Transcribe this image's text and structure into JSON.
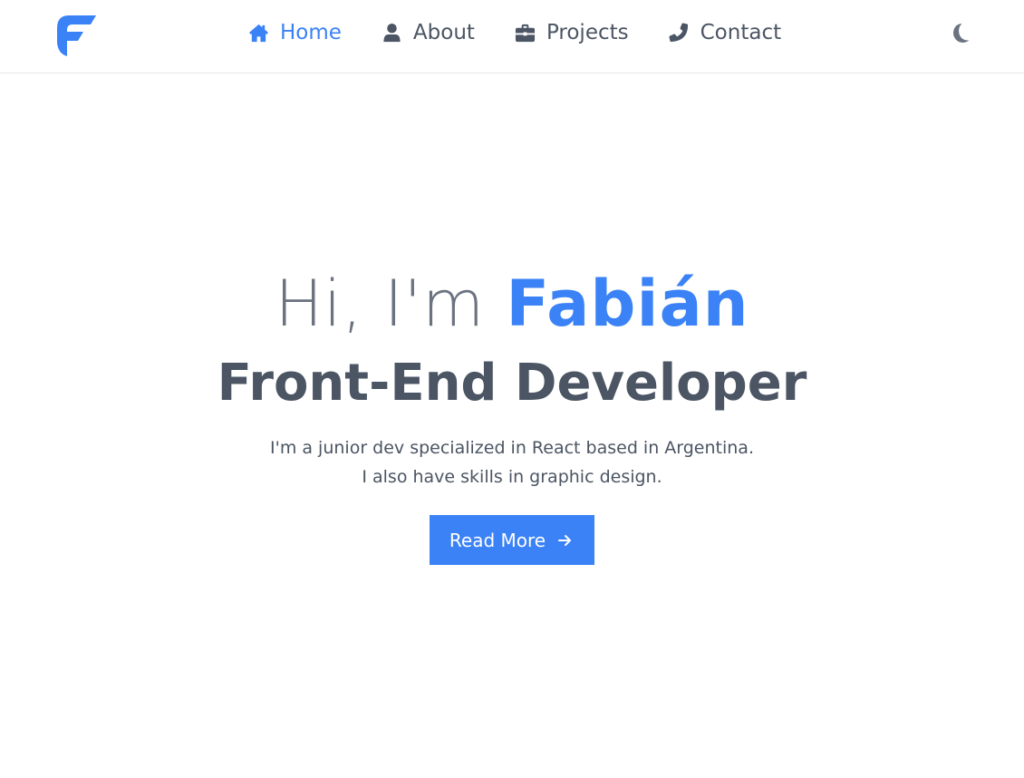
{
  "navbar": {
    "logo_icon": "f-logo-icon",
    "items": [
      {
        "label": "Home",
        "icon": "home-icon",
        "active": true
      },
      {
        "label": "About",
        "icon": "user-icon",
        "active": false
      },
      {
        "label": "Projects",
        "icon": "briefcase-icon",
        "active": false
      },
      {
        "label": "Contact",
        "icon": "phone-icon",
        "active": false
      }
    ],
    "theme_toggle_icon": "moon-icon"
  },
  "hero": {
    "greeting_prefix": "Hi, I'm",
    "greeting_name": "Fabián",
    "role": "Front-End Developer",
    "description_lines": [
      "I'm a junior dev specialized in React based in Argentina.",
      "I also have skills in graphic design."
    ],
    "cta_label": "Read More",
    "cta_icon": "arrow-right-icon"
  },
  "colors": {
    "accent": "#3b82f6",
    "text": "#4b5563",
    "muted": "#6b7280",
    "background": "#ffffff",
    "border": "#e5e7eb"
  }
}
